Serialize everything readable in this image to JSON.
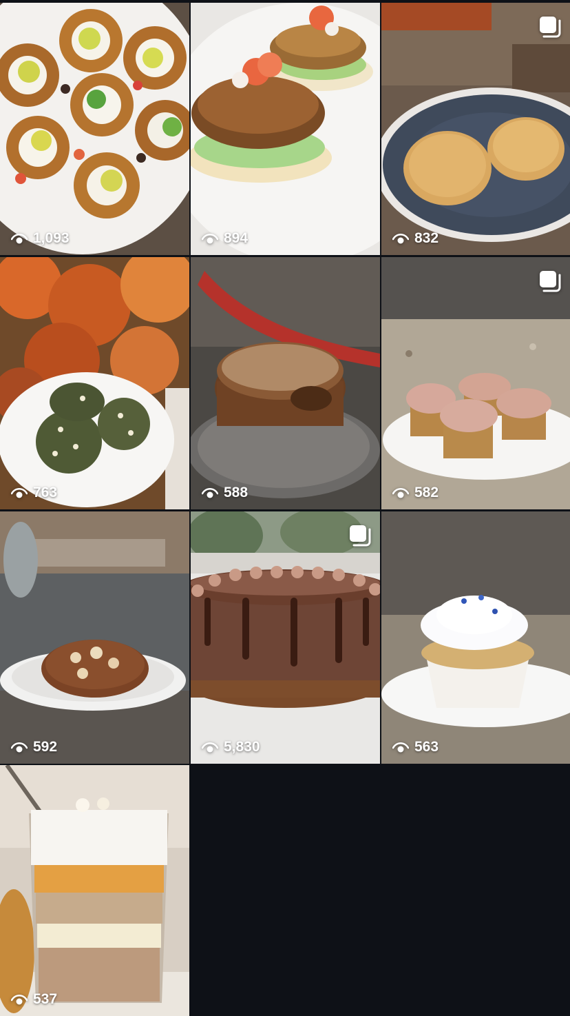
{
  "grid": {
    "posts": [
      {
        "views": "1,093",
        "subject": "taco-cups",
        "multi": false
      },
      {
        "views": "894",
        "subject": "veggie-sliders",
        "multi": false
      },
      {
        "views": "832",
        "subject": "crinkle-cookies",
        "multi": true
      },
      {
        "views": "763",
        "subject": "matcha-cookies",
        "multi": false
      },
      {
        "views": "588",
        "subject": "crumb-cake",
        "multi": false
      },
      {
        "views": "582",
        "subject": "pecan-muffins",
        "multi": true
      },
      {
        "views": "592",
        "subject": "stuffed-cookie",
        "multi": false
      },
      {
        "views": "5,830",
        "subject": "chocolate-drip-cake",
        "multi": true
      },
      {
        "views": "563",
        "subject": "vanilla-cupcake",
        "multi": false
      },
      {
        "views": "537",
        "subject": "layered-dessert-cup",
        "multi": false
      }
    ]
  },
  "colors": {
    "background": "#0e1117",
    "overlay_text": "#ffffff"
  },
  "icons": {
    "views": "eye-icon",
    "multi": "carousel-icon"
  }
}
